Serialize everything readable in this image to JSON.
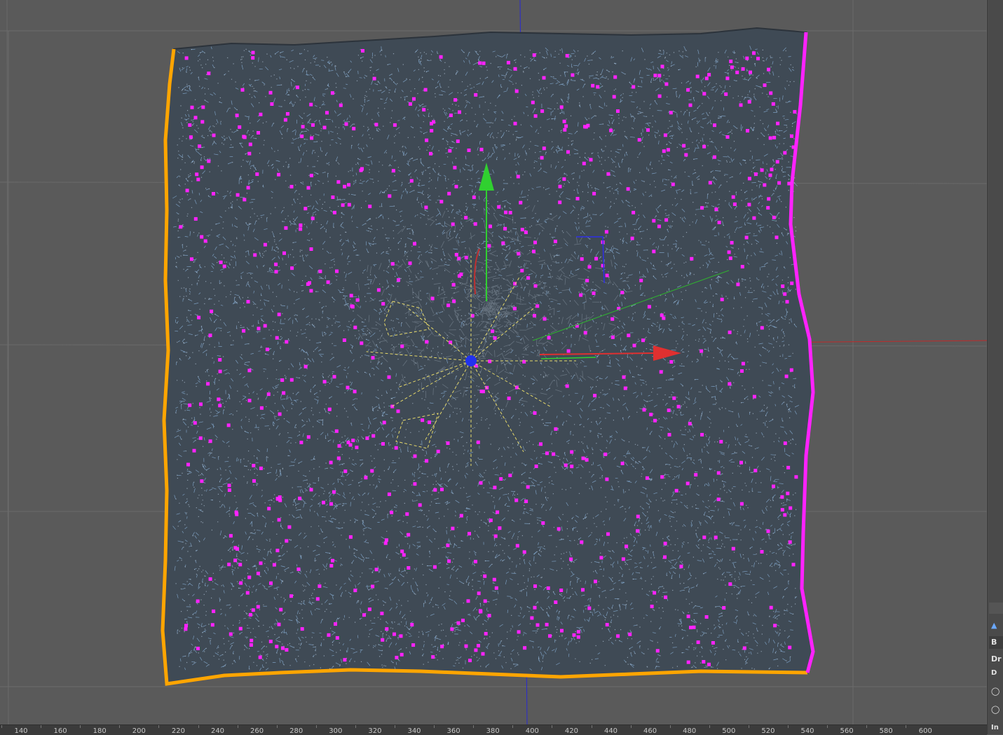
{
  "app": "3D viewport - cloth mesh editor",
  "viewport": {
    "background": "#5a5a5a",
    "mesh_fill": "#3f4a55",
    "edge_color": "#8fb9e3",
    "pinned_left_color": "#ffa500",
    "pinned_right_color": "#ff22ff",
    "selected_vertex_color": "#ff22ff",
    "gizmo": {
      "x_axis_color": "#e03030",
      "y_axis_color": "#30d030",
      "z_axis_color": "#2e2ee6",
      "pivot_color": "#2233ee"
    },
    "light_gizmo_color": "#e6d96a"
  },
  "right_panel": {
    "tabs": [
      "B",
      "Dr",
      "D",
      "In"
    ]
  },
  "ruler": {
    "ticks": [
      "140",
      "160",
      "180",
      "200",
      "220",
      "240",
      "260",
      "280",
      "300",
      "320",
      "340",
      "360",
      "380",
      "400",
      "420",
      "440",
      "460",
      "480",
      "500",
      "520",
      "540",
      "560",
      "580",
      "600"
    ]
  }
}
